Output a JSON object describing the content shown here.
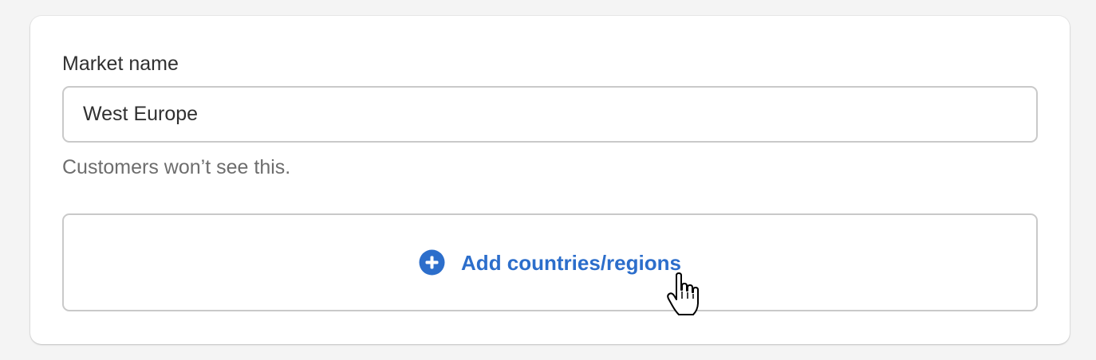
{
  "form": {
    "market_name_label": "Market name",
    "market_name_value": "West Europe",
    "help_text": "Customers won’t see this.",
    "add_button_label": "Add countries/regions"
  },
  "icons": {
    "add": "plus-circle-icon",
    "cursor": "hand-pointer-cursor-icon"
  },
  "colors": {
    "accent": "#2c6ecb",
    "label_text": "#303030",
    "help_text": "#6d6d6d",
    "border": "#c9c9c9",
    "page_background": "#f4f4f4",
    "card_background": "#ffffff"
  }
}
